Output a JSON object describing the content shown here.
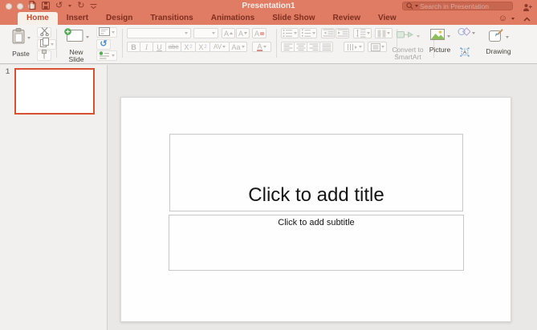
{
  "window": {
    "title": "Presentation1"
  },
  "titlebar": {
    "search_placeholder": "Search in Presentation"
  },
  "icons": {
    "undo": "↺",
    "redo": "↻",
    "feedback": "☺",
    "reset": "↺"
  },
  "tabs": [
    {
      "label": "Home",
      "active": true
    },
    {
      "label": "Insert",
      "active": false
    },
    {
      "label": "Design",
      "active": false
    },
    {
      "label": "Transitions",
      "active": false
    },
    {
      "label": "Animations",
      "active": false
    },
    {
      "label": "Slide Show",
      "active": false
    },
    {
      "label": "Review",
      "active": false
    },
    {
      "label": "View",
      "active": false
    }
  ],
  "ribbon": {
    "paste_label": "Paste",
    "new_slide_line1": "New",
    "new_slide_line2": "Slide",
    "font": {
      "bold": "B",
      "italic": "I",
      "underline": "U",
      "strikethrough": "abc",
      "sup_base": "X",
      "sup_exp": "2",
      "sub_base": "X",
      "sub_sub": "2",
      "char_spacing": "AV",
      "change_case": "Aa",
      "font_color": "A",
      "grow_font": "A",
      "shrink_font": "A",
      "clear_format": "A"
    },
    "smartart_line1": "Convert to",
    "smartart_line2": "SmartArt",
    "picture_label": "Picture",
    "textbox_glyph": "A",
    "drawing_label": "Drawing"
  },
  "thumbnails": {
    "slide_number": "1"
  },
  "slide": {
    "title_placeholder": "Click to add title",
    "subtitle_placeholder": "Click to add subtitle"
  },
  "colors": {
    "titlebar": "#e17c64",
    "active_tab_text": "#c64a2c",
    "selection_border": "#d9512e"
  }
}
